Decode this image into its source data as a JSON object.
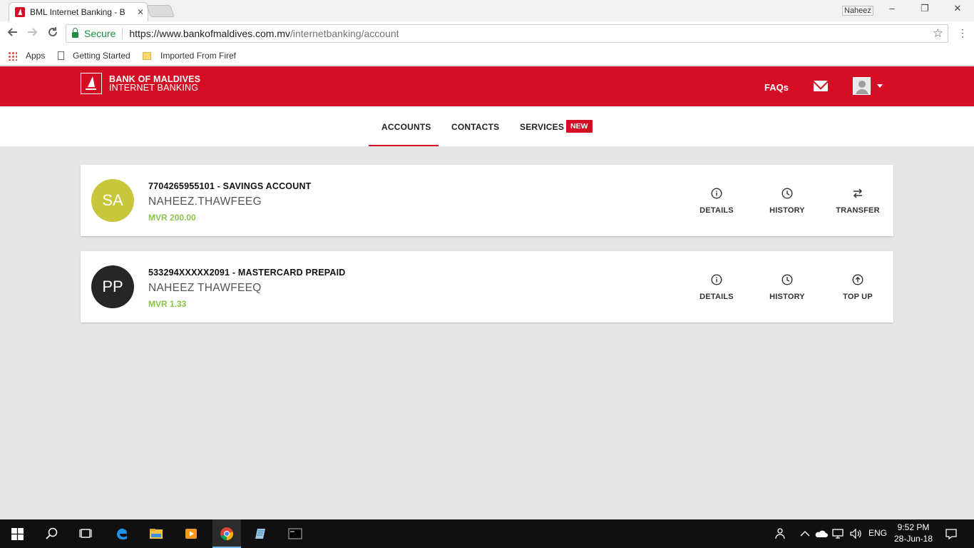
{
  "browser": {
    "tab_title": "BML Internet Banking - B",
    "tab_close": "✕",
    "profile_name": "Naheez",
    "window_controls": {
      "minimize": "–",
      "restore": "❐",
      "close": "✕"
    },
    "secure_label": "Secure",
    "url_host": "https://www.bankofmaldives.com.mv",
    "url_path": "/internetbanking/account",
    "bookmarks": [
      {
        "label": "Apps",
        "icon": "apps-icon"
      },
      {
        "label": "Getting Started",
        "icon": "page-icon"
      },
      {
        "label": "Imported From Firef",
        "icon": "folder-icon"
      }
    ]
  },
  "header": {
    "logo_line1": "BANK OF MALDIVES",
    "logo_line2": "INTERNET BANKING",
    "faqs": "FAQs",
    "brand_color": "#d40e24"
  },
  "nav": {
    "tabs": [
      {
        "label": "ACCOUNTS",
        "active": true
      },
      {
        "label": "CONTACTS",
        "active": false
      },
      {
        "label": "SERVICES",
        "active": false
      }
    ],
    "new_badge": "NEW"
  },
  "accounts": [
    {
      "initials": "SA",
      "avatar_color": "#c8c63a",
      "title": "7704265955101 - SAVINGS ACCOUNT",
      "name": "NAHEEZ.THAWFEEG",
      "balance": "MVR 200.00",
      "actions": [
        {
          "label": "DETAILS",
          "icon": "info-icon"
        },
        {
          "label": "HISTORY",
          "icon": "clock-icon"
        },
        {
          "label": "TRANSFER",
          "icon": "transfer-icon"
        }
      ]
    },
    {
      "initials": "PP",
      "avatar_color": "#262626",
      "title": "533294XXXXX2091 - MASTERCARD PREPAID",
      "name": "NAHEEZ THAWFEEQ",
      "balance": "MVR 1.33",
      "actions": [
        {
          "label": "DETAILS",
          "icon": "info-icon"
        },
        {
          "label": "HISTORY",
          "icon": "clock-icon"
        },
        {
          "label": "TOP UP",
          "icon": "upload-circle-icon"
        }
      ]
    }
  ],
  "taskbar": {
    "language": "ENG",
    "time": "9:52 PM",
    "date": "28-Jun-18"
  }
}
